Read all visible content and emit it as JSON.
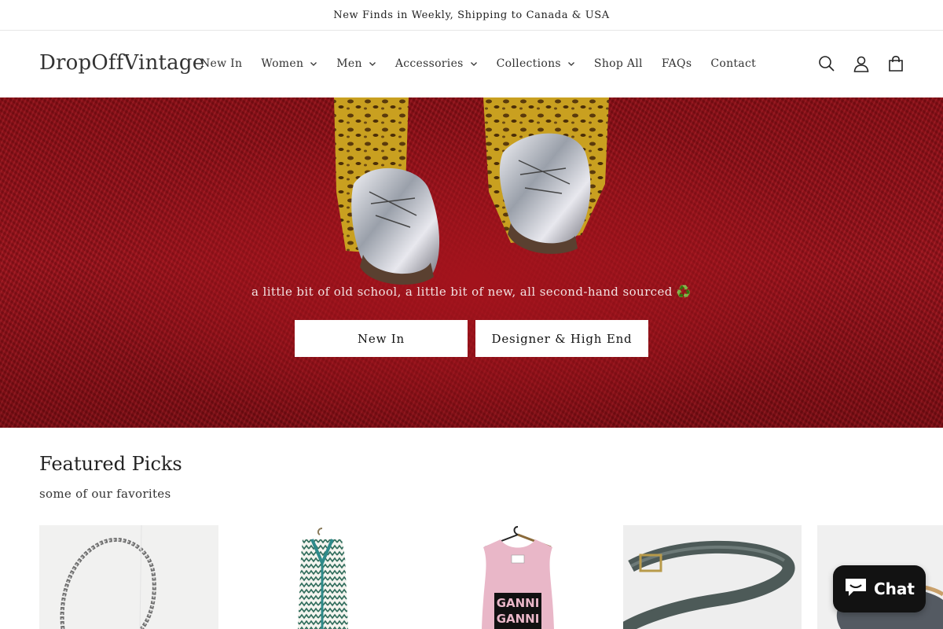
{
  "announcement": {
    "text": "New Finds in Weekly, Shipping to Canada & USA"
  },
  "header": {
    "logo": "DropOffVintage",
    "nav": [
      {
        "label": "New In",
        "has_dropdown": false
      },
      {
        "label": "Women",
        "has_dropdown": true
      },
      {
        "label": "Men",
        "has_dropdown": true
      },
      {
        "label": "Accessories",
        "has_dropdown": true
      },
      {
        "label": "Collections",
        "has_dropdown": true
      },
      {
        "label": "Shop All",
        "has_dropdown": false
      },
      {
        "label": "FAQs",
        "has_dropdown": false
      },
      {
        "label": "Contact",
        "has_dropdown": false
      }
    ],
    "icons": [
      "search-icon",
      "account-icon",
      "cart-icon"
    ]
  },
  "hero": {
    "tagline": "a little bit of old school, a little bit of new, all second-hand sourced ♻️",
    "buttons": [
      {
        "label": "New In"
      },
      {
        "label": "Designer & High End"
      }
    ]
  },
  "featured": {
    "title": "Featured Picks",
    "subtitle": "some of our favorites",
    "products": [
      {
        "name": "chain-necklace"
      },
      {
        "name": "striped-knit-vest"
      },
      {
        "name": "ganni-pink-sweater-vest",
        "print": "GANNI"
      },
      {
        "name": "leather-belt"
      },
      {
        "name": "flat-shoes"
      }
    ]
  },
  "chat": {
    "label": "Chat"
  },
  "colors": {
    "hero_red": "#9b111a",
    "chat_bg": "#121212",
    "text": "#121212"
  }
}
